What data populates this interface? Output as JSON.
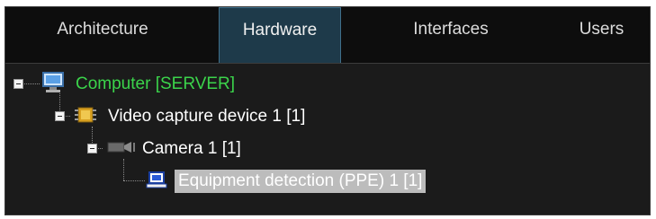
{
  "tabs": [
    {
      "label": "Architecture",
      "active": false
    },
    {
      "label": "Hardware",
      "active": true
    },
    {
      "label": "Interfaces",
      "active": false
    },
    {
      "label": "Users",
      "active": false
    }
  ],
  "tree": {
    "computer": {
      "label": "Computer [SERVER]",
      "color": "#3bd44b",
      "icon": "monitor-icon",
      "expanded": true
    },
    "capture": {
      "label": "Video capture device 1 [1]",
      "color": "#ffffff",
      "icon": "chip-icon",
      "expanded": true
    },
    "camera": {
      "label": "Camera 1 [1]",
      "color": "#ffffff",
      "icon": "camera-icon",
      "expanded": true
    },
    "detection": {
      "label": "Equipment detection (PPE) 1 [1]",
      "color": "#ffffff",
      "icon": "laptop-icon",
      "selected": true
    }
  },
  "colors": {
    "accent_tab": "#1e3a4a",
    "selection": "#bcbcbc",
    "background": "#1b1b1b"
  }
}
